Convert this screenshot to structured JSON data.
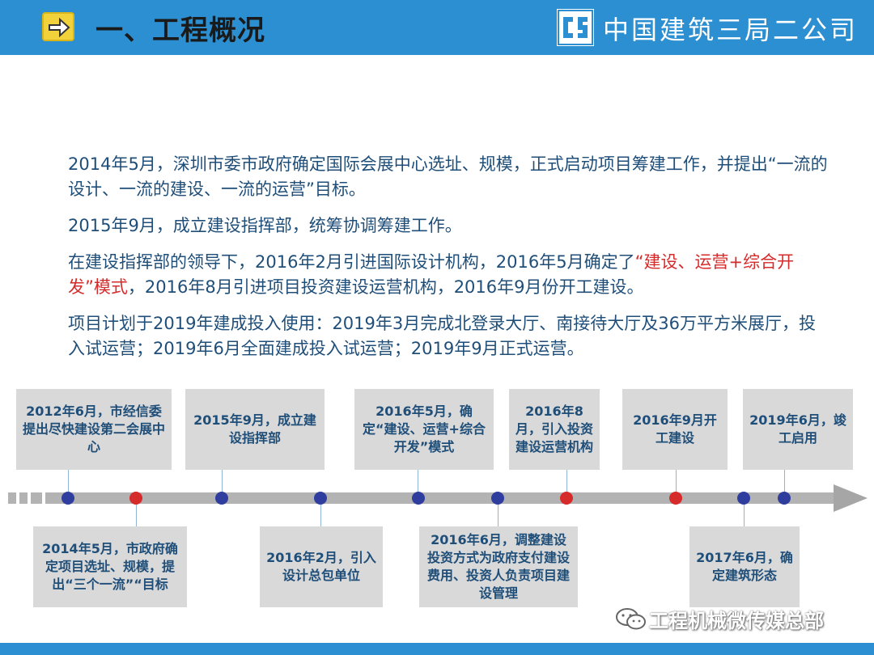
{
  "header": {
    "title": "一、工程概况",
    "company": "中国建筑三局二公司",
    "bg_color": "#2b8fd1"
  },
  "paragraphs": [
    {
      "text": "2014年5月，深圳市委市政府确定国际会展中心选址、规模，正式启动项目筹建工作，并提出“一流的设计、一流的建设、一流的运营”目标。"
    },
    {
      "text": "2015年9月，成立建设指挥部，统筹协调筹建工作。"
    },
    {
      "pre": "在建设指挥部的领导下，2016年2月引进国际设计机构，2016年5月确定了",
      "highlight": "“建设、运营+综合开发”模式",
      "post": "，2016年8月引进项目投资建设运营机构，2016年9月份开工建设。"
    },
    {
      "text": "项目计划于2019年建成投入使用：2019年3月完成北登录大厅、南接待大厅及36万平方米展厅，投入试运营；2019年6月全面建成投入试运营；2019年9月正式运营。"
    }
  ],
  "timeline": {
    "top_events": [
      "2012年6月，市经信委提出尽快建设第二会展中心",
      "2015年9月，成立建设指挥部",
      "2016年5月，确定“建设、运营+综合开发”模式",
      "2016年8月，引入投资建设运营机构",
      "2016年9月开工建设",
      "2019年6月，竣工启用"
    ],
    "bottom_events": [
      "2014年5月，市政府确定项目选址、规模，提出“三个一流”“目标",
      "2016年2月，引入设计总包单位",
      "2016年6月，调整建设投资方式为政府支付建设费用、投资人负责项目建设管理",
      "2017年6月，确定建筑形态"
    ],
    "dot_colors": [
      "blue",
      "red",
      "blue",
      "blue",
      "blue",
      "blue",
      "red",
      "red",
      "blue",
      "blue"
    ]
  },
  "watermark": "工程机械微传媒总部",
  "colors": {
    "accent_blue": "#2b8fd1",
    "text_blue": "#1f4e79",
    "highlight_red": "#d62b2b",
    "dot_blue": "#2f3d9e",
    "box_gray": "#d9d9d9"
  }
}
